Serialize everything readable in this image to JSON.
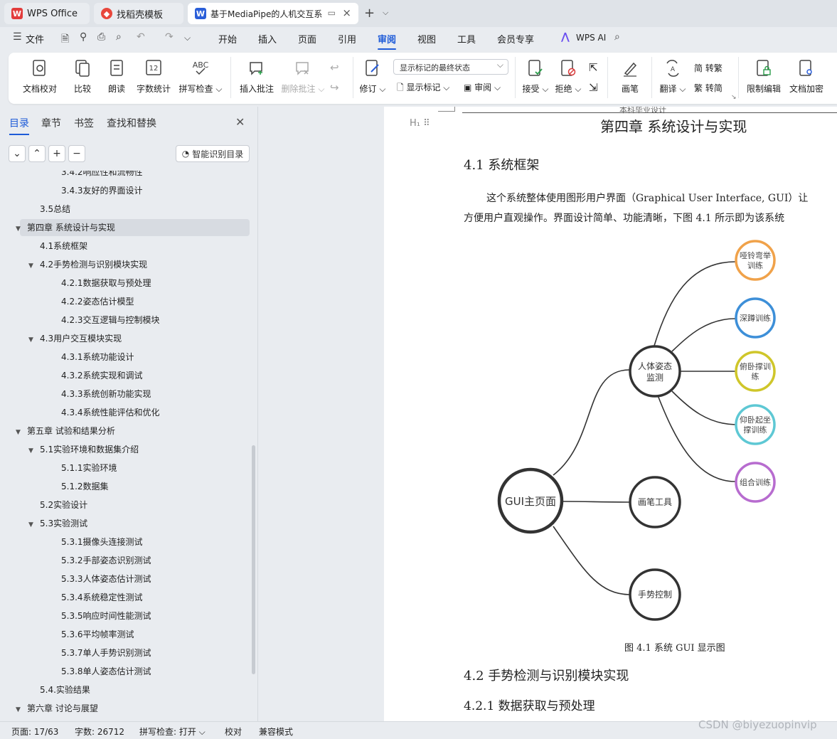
{
  "titlebar": {
    "tabs": [
      {
        "label": "WPS Office"
      },
      {
        "label": "找稻壳模板"
      },
      {
        "label": "基于MediaPipe的人机交互系"
      }
    ]
  },
  "menu": {
    "file": "文件",
    "items": [
      "开始",
      "插入",
      "页面",
      "引用",
      "审阅",
      "视图",
      "工具",
      "会员专享"
    ],
    "active": "审阅",
    "wps_ai": "WPS AI"
  },
  "ribbon": {
    "doc_check": "文档校对",
    "compare": "比较",
    "read_aloud": "朗读",
    "word_count": "字数统计",
    "spell_check": "拼写检查",
    "insert_comment": "插入批注",
    "delete_comment": "删除批注",
    "revise": "修订",
    "markup_state": "显示标记的最终状态",
    "show_markup": "显示标记",
    "review": "审阅",
    "accept": "接受",
    "reject": "拒绝",
    "pen": "画笔",
    "translate": "翻译",
    "to_traditional": "简 转繁",
    "to_simplified": "繁 转简",
    "restrict_edit": "限制编辑",
    "doc_encrypt": "文档加密",
    "icon_word_count": "12",
    "icon_spell": "ABC"
  },
  "panel": {
    "tabs": [
      "目录",
      "章节",
      "书签",
      "查找和替换"
    ],
    "smart_toc": "智能识别目录",
    "toc": [
      {
        "text": "3.4.2响应性和流畅性",
        "level": 3
      },
      {
        "text": "3.4.3友好的界面设计",
        "level": 3
      },
      {
        "text": "3.5总结",
        "level": 2
      },
      {
        "text": "第四章 系统设计与实现",
        "level": 1,
        "expanded": true,
        "selected": true
      },
      {
        "text": "4.1系统框架",
        "level": 2
      },
      {
        "text": "4.2手势检测与识别模块实现",
        "level": 2,
        "expanded": true
      },
      {
        "text": "4.2.1数据获取与预处理",
        "level": 3
      },
      {
        "text": "4.2.2姿态估计模型",
        "level": 3
      },
      {
        "text": "4.2.3交互逻辑与控制模块",
        "level": 3
      },
      {
        "text": "4.3用户交互模块实现",
        "level": 2,
        "expanded": true
      },
      {
        "text": "4.3.1系统功能设计",
        "level": 3
      },
      {
        "text": "4.3.2系统实现和调试",
        "level": 3
      },
      {
        "text": "4.3.3系统创新功能实现",
        "level": 3
      },
      {
        "text": "4.3.4系统性能评估和优化",
        "level": 3
      },
      {
        "text": "第五章 试验和结果分析",
        "level": 1,
        "expanded": true
      },
      {
        "text": "5.1实验环境和数据集介绍",
        "level": 2,
        "expanded": true
      },
      {
        "text": "5.1.1实验环境",
        "level": 3
      },
      {
        "text": "5.1.2数据集",
        "level": 3
      },
      {
        "text": "5.2实验设计",
        "level": 2
      },
      {
        "text": "5.3实验测试",
        "level": 2,
        "expanded": true
      },
      {
        "text": "5.3.1摄像头连接测试",
        "level": 3
      },
      {
        "text": "5.3.2手部姿态识别测试",
        "level": 3
      },
      {
        "text": "5.3.3人体姿态估计测试",
        "level": 3
      },
      {
        "text": "5.3.4系统稳定性测试",
        "level": 3
      },
      {
        "text": "5.3.5响应时间性能测试",
        "level": 3
      },
      {
        "text": "5.3.6平均帧率测试",
        "level": 3
      },
      {
        "text": "5.3.7单人手势识别测试",
        "level": 3
      },
      {
        "text": "5.3.8单人姿态估计测试",
        "level": 3
      },
      {
        "text": "5.4.实验结果",
        "level": 2
      },
      {
        "text": "第六章 讨论与展望",
        "level": 1,
        "expanded": true
      }
    ]
  },
  "document": {
    "header": "本科毕业设计",
    "chapter_title": "第四章  系统设计与实现",
    "section_41": "4.1  系统框架",
    "para_line1": "这个系统整体使用图形用户界面（Graphical User Interface, GUI）让",
    "para_line2": "方便用户直观操作。界面设计简单、功能清晰，下图 4.1 所示即为该系统",
    "figure": {
      "root": "GUI主页面",
      "branches": [
        "人体姿态监测",
        "画笔工具",
        "手势控制"
      ],
      "leaves": [
        {
          "label": "哑铃弯举训练",
          "color": "#f0a24a"
        },
        {
          "label": "深蹲训练",
          "color": "#3d8fd8"
        },
        {
          "label": "俯卧撑训练",
          "color": "#cfc62a"
        },
        {
          "label": "仰卧起坐撑训练",
          "color": "#5ec8d4"
        },
        {
          "label": "组合训练",
          "color": "#b76ccf"
        }
      ]
    },
    "caption": "图 4.1 系统 GUI 显示图",
    "section_42": "4.2 手势检测与识别模块实现",
    "section_421": "4.2.1  数据获取与预处理"
  },
  "status": {
    "page": "页面: 17/63",
    "words": "字数: 26712",
    "spell": "拼写检查: 打开",
    "proof": "校对",
    "compat": "兼容模式"
  },
  "watermark": "CSDN @biyezuopinvip",
  "colors": {
    "accent": "#1e5bd8",
    "wps_red": "#e23c3c",
    "doc_blue": "#2b5fd9"
  }
}
